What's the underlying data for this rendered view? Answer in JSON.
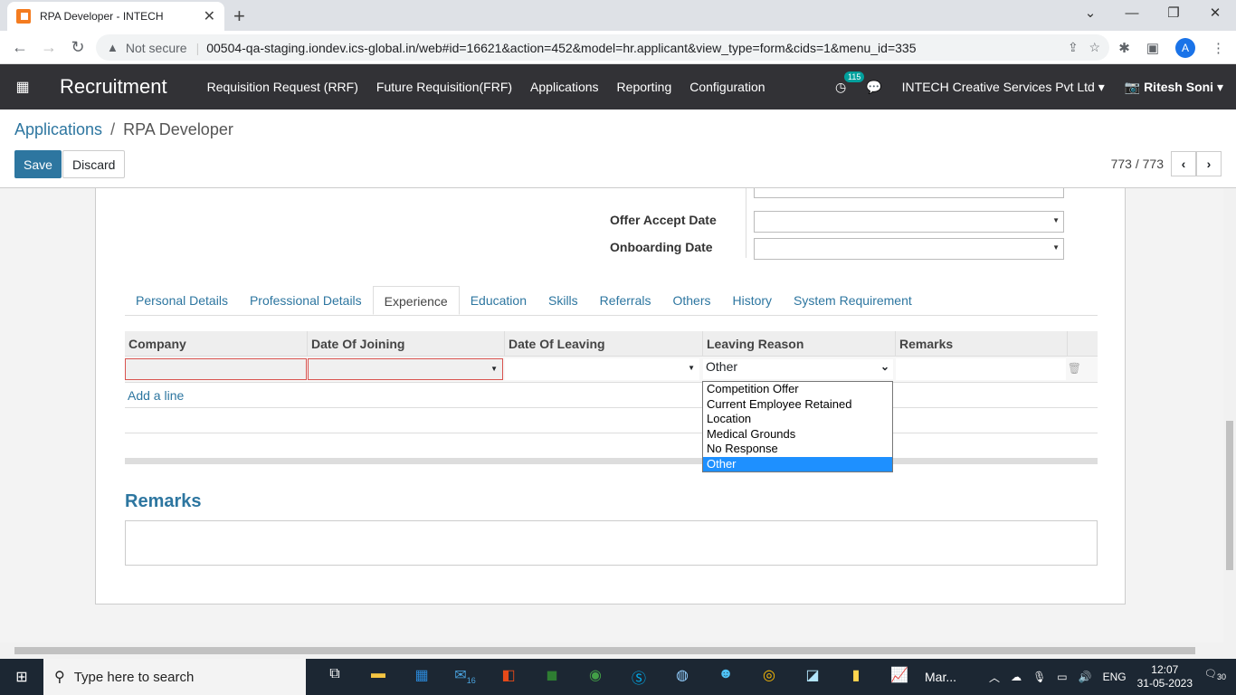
{
  "browser": {
    "tab_title": "RPA Developer - INTECH",
    "new_tab": "+",
    "not_secure": "Not secure",
    "url": "00504-qa-staging.iondev.ics-global.in/web#id=16621&action=452&model=hr.applicant&view_type=form&cids=1&menu_id=335",
    "avatar_letter": "A"
  },
  "navbar": {
    "brand": "Recruitment",
    "menu": [
      "Requisition Request (RRF)",
      "Future Requisition(FRF)",
      "Applications",
      "Reporting",
      "Configuration"
    ],
    "activity_count": "115",
    "company": "INTECH Creative Services Pvt Ltd",
    "user": "Ritesh Soni"
  },
  "control": {
    "breadcrumb_parent": "Applications",
    "breadcrumb_sep": "/",
    "breadcrumb_current": "RPA Developer",
    "save_label": "Save",
    "discard_label": "Discard",
    "pager": "773 / 773"
  },
  "form": {
    "offer_accept_label": "Offer Accept Date",
    "onboarding_label": "Onboarding Date",
    "tabs": [
      "Personal Details",
      "Professional Details",
      "Experience",
      "Education",
      "Skills",
      "Referrals",
      "Others",
      "History",
      "System Requirement"
    ],
    "active_tab": "Experience",
    "columns": [
      "Company",
      "Date Of Joining",
      "Date Of Leaving",
      "Leaving Reason",
      "Remarks"
    ],
    "leaving_reason_value": "Other",
    "add_line": "Add a line",
    "remarks_title": "Remarks",
    "dropdown_options": [
      "Competition Offer",
      "Current Employee Retained",
      "Location",
      "Medical Grounds",
      "No Response",
      "Other"
    ],
    "dropdown_selected": "Other"
  },
  "taskbar": {
    "search_placeholder": "Type here to search",
    "mail_badge": "16",
    "app_label": "Mar...",
    "lang": "ENG",
    "time": "12:07",
    "date": "31-05-2023",
    "notif_count": "30"
  },
  "colors": {
    "navbar": "#323236",
    "accent": "#2d76a0",
    "dropdown_highlight": "#1e90ff"
  }
}
